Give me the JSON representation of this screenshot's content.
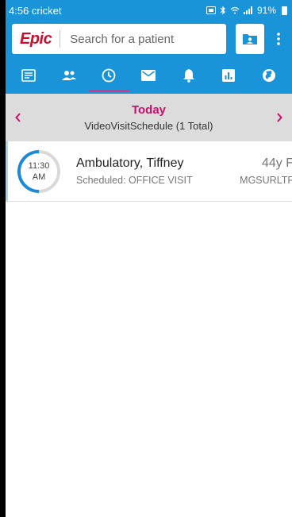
{
  "status_bar": {
    "time": "4:56",
    "carrier": "cricket",
    "battery": "91%"
  },
  "header": {
    "logo": "Epic",
    "search_placeholder": "Search for a patient"
  },
  "tabs": [
    {
      "name": "schedule-list-icon"
    },
    {
      "name": "patients-icon"
    },
    {
      "name": "clock-icon",
      "active": true
    },
    {
      "name": "mail-icon"
    },
    {
      "name": "bell-icon"
    },
    {
      "name": "chart-icon"
    },
    {
      "name": "globe-icon"
    }
  ],
  "day_nav": {
    "title": "Today",
    "subtitle": "VideoVisitSchedule (1 Total)"
  },
  "appointments": [
    {
      "time": "11:30",
      "ampm": "AM",
      "patient": "Ambulatory, Tiffney",
      "status": "Scheduled: OFFICE VISIT",
      "age_sex": "44y F",
      "department": "MGSURLTF"
    }
  ],
  "colors": {
    "brand_blue": "#1a94d9",
    "accent_pink": "#c8106a",
    "tab_indicator": "#e0338a",
    "epic_red": "#c8102e"
  }
}
